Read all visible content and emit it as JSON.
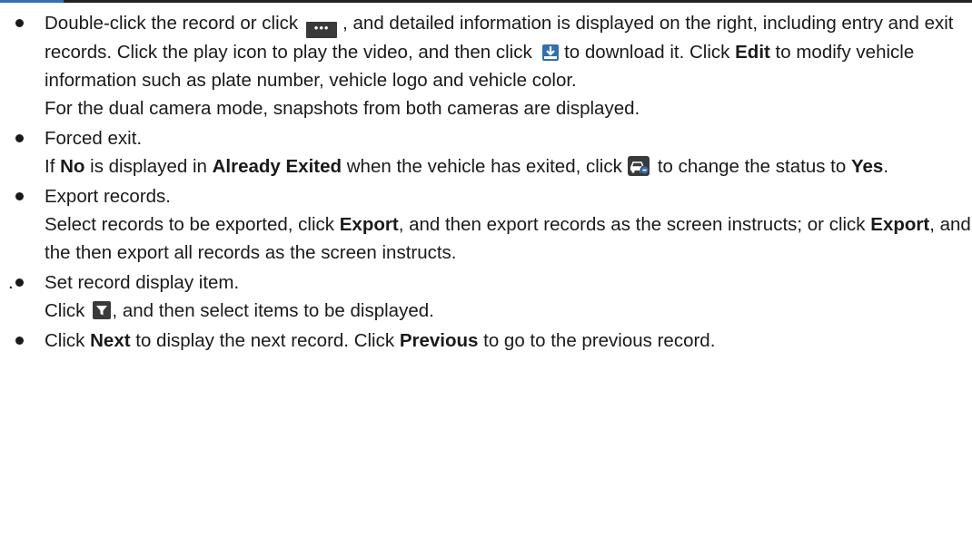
{
  "icons": {
    "more": "more-icon",
    "download": "download-icon",
    "forced_exit": "forced-exit-icon",
    "filter": "filter-icon",
    "more_glyph": "•••"
  },
  "colors": {
    "text": "#1a1a1a",
    "icon_dark": "#3a3a3a",
    "icon_blue": "#2f6fb3"
  },
  "items": [
    {
      "t1": "Double-click the record or click",
      "t2": ", and detailed information is displayed on the right, including entry and exit records. Click the play icon to play the video, and then click",
      "t3": "to download it. Click",
      "edit": "Edit",
      "t4": "to modify vehicle information such as plate number, vehicle logo and vehicle color.",
      "note": "For the dual camera mode, snapshots from both cameras are displayed."
    },
    {
      "title": "Forced exit.",
      "t1": "If",
      "no": "No",
      "t2": "is displayed in",
      "already_exited": "Already Exited",
      "t3": "when the vehicle has exited, click",
      "t4": "to change the status to",
      "yes": "Yes",
      "t5": "."
    },
    {
      "title": "Export records.",
      "t1": "Select records to be exported, click",
      "export": "Export",
      "t2": ", and then export records as the screen instructs; or click",
      "t3": ", and the then export all records as the screen instructs."
    },
    {
      "prefix": ".",
      "title": "Set record display item.",
      "t1": "Click",
      "t2": ", and then select items to be displayed."
    },
    {
      "t1": "Click",
      "next": "Next",
      "t2": "to display the next record. Click",
      "previous": "Previous",
      "t3": "to go to the previous record."
    }
  ]
}
